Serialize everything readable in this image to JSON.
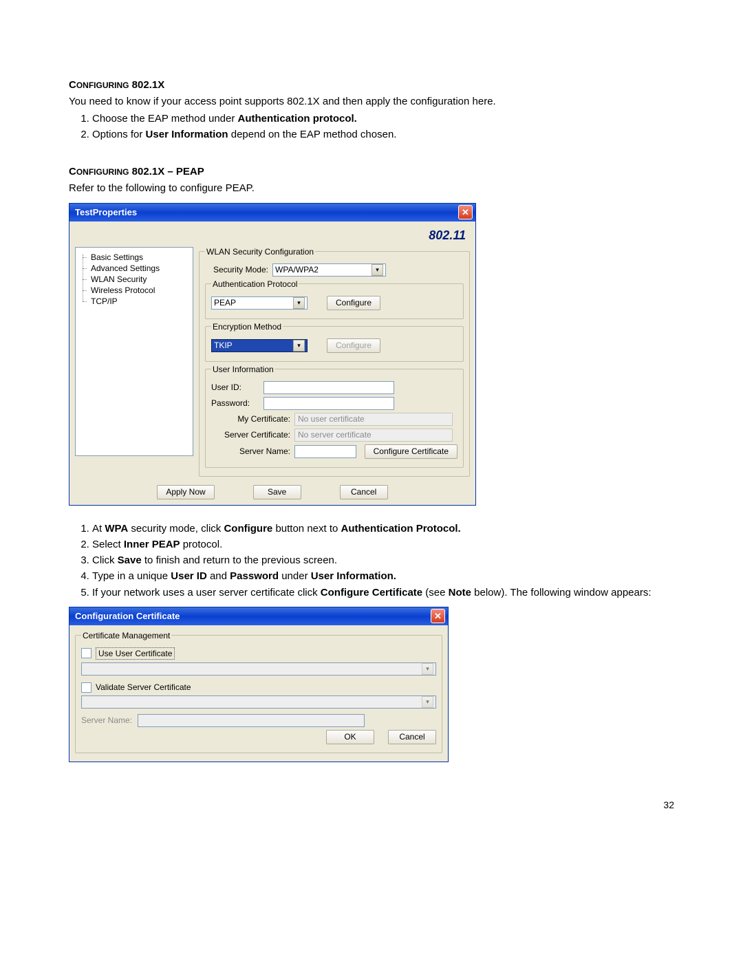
{
  "section1": {
    "heading_caps": "C",
    "heading_rest": "ONFIGURING",
    "heading_tail": " 802.1X",
    "intro": "You need to know if your access point supports 802.1X and then apply the configuration here.",
    "steps": {
      "s1a": "Choose the EAP method under ",
      "s1b": "Authentication protocol.",
      "s2a": "Options for ",
      "s2b": "User Information",
      "s2c": " depend on the EAP method chosen."
    }
  },
  "section2": {
    "heading_caps": "C",
    "heading_rest": "ONFIGURING",
    "heading_tail": " 802.1X – PEAP",
    "intro": "Refer to the following to configure PEAP."
  },
  "win1": {
    "title": "TestProperties",
    "brand": "802.11",
    "tree": {
      "t0": "Basic Settings",
      "t1": "Advanced Settings",
      "t2": "WLAN Security",
      "t3": "Wireless Protocol",
      "t4": "TCP/IP"
    },
    "fs_wlan": "WLAN Security Configuration",
    "lbl_secmode": "Security Mode:",
    "val_secmode": "WPA/WPA2",
    "fs_auth": "Authentication Protocol",
    "val_auth": "PEAP",
    "btn_configure": "Configure",
    "fs_enc": "Encryption Method",
    "val_enc": "TKIP",
    "btn_configure2": "Configure",
    "fs_user": "User Information",
    "lbl_userid": "User ID:",
    "lbl_password": "Password:",
    "lbl_mycert": "My Certificate:",
    "val_mycert": "No user certificate",
    "lbl_srvcert": "Server Certificate:",
    "val_srvcert": "No server certificate",
    "lbl_srvname": "Server Name:",
    "btn_confcert": "Configure Certificate",
    "btn_apply": "Apply Now",
    "btn_save": "Save",
    "btn_cancel": "Cancel"
  },
  "peap_steps": {
    "s1a": "At ",
    "s1b": "WPA",
    "s1c": " security mode, click ",
    "s1d": "Configure",
    "s1e": " button next to ",
    "s1f": "Authentication Protocol.",
    "s2a": "Select ",
    "s2b": "Inner PEAP",
    "s2c": " protocol.",
    "s3a": "Click ",
    "s3b": "Save",
    "s3c": " to finish and return to the previous screen.",
    "s4a": "Type in a unique ",
    "s4b": "User ID",
    "s4c": " and ",
    "s4d": "Password",
    "s4e": " under ",
    "s4f": "User Information.",
    "s5a": "If your network uses a user server certificate click ",
    "s5b": "Configure Certificate",
    "s5c": " (see ",
    "s5d": "Note",
    "s5e": " below). The following window appears:"
  },
  "win2": {
    "title": "Configuration Certificate",
    "fs_cm": "Certificate Management",
    "chk_user": "Use User Certificate",
    "chk_validate": "Validate Server Certificate",
    "lbl_srvname": "Server Name:",
    "btn_ok": "OK",
    "btn_cancel": "Cancel"
  },
  "page_number": "32"
}
